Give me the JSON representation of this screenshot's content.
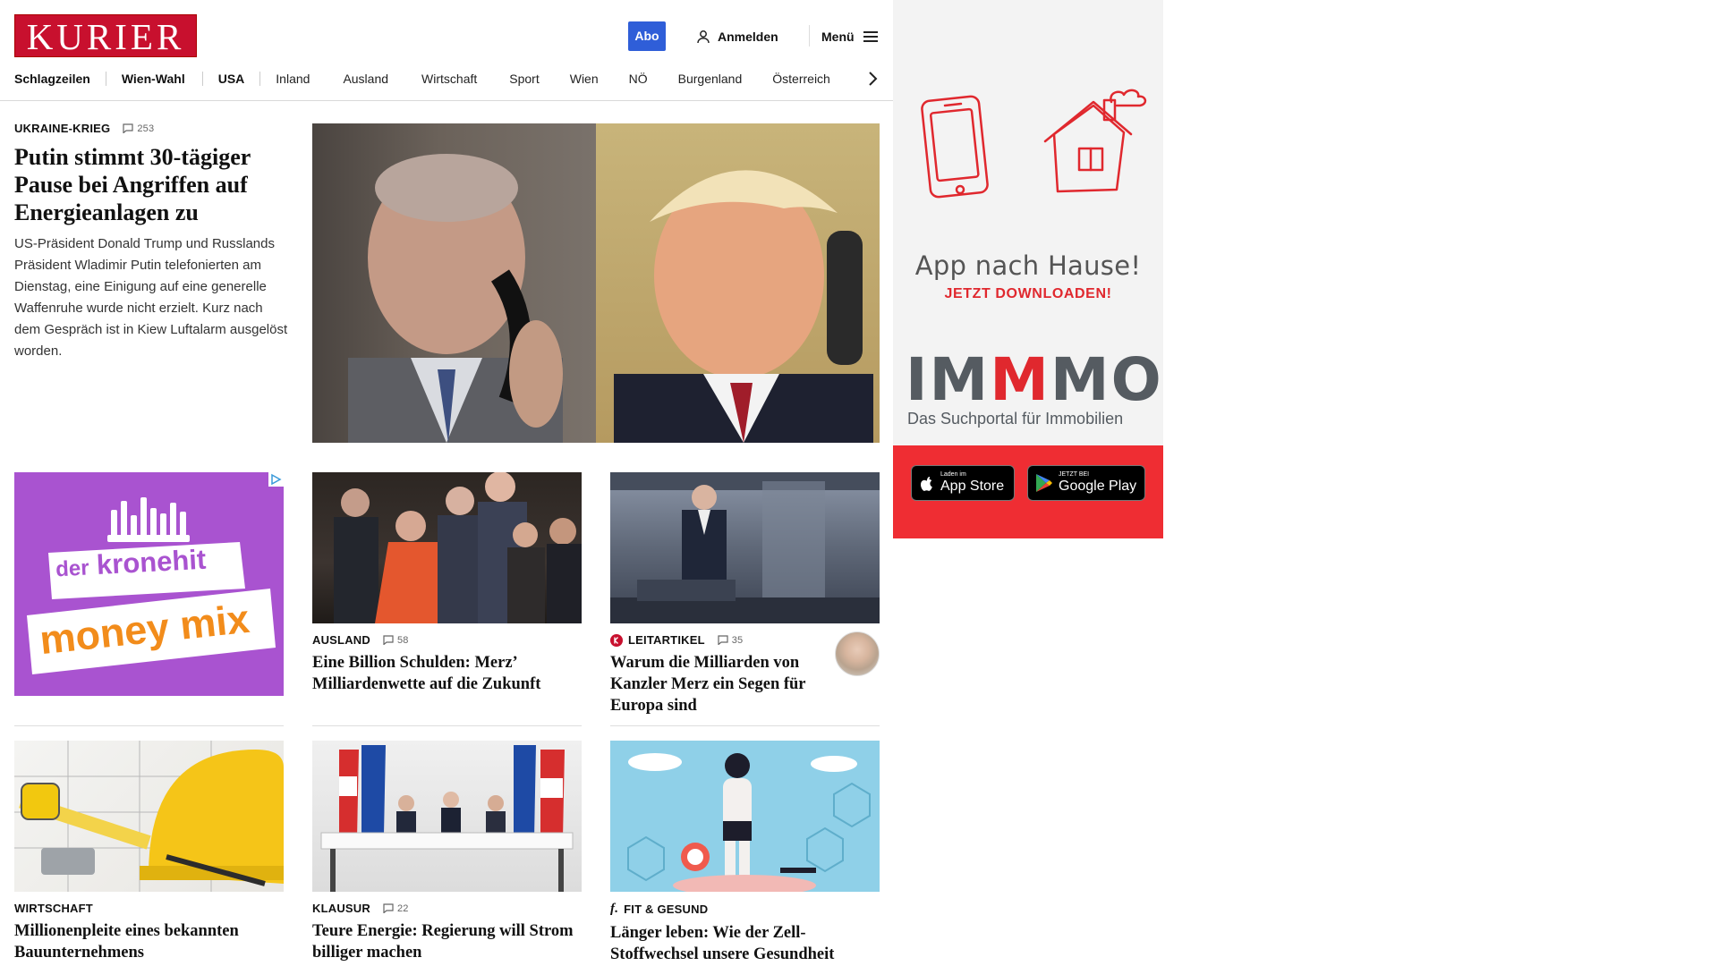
{
  "header": {
    "logo": "KURIER",
    "abo_label": "Abo",
    "login_label": "Anmelden",
    "menu_label": "Menü"
  },
  "nav": {
    "items": [
      {
        "label": "Schlagzeilen",
        "strong": true
      },
      {
        "label": "Wien-Wahl",
        "strong": true
      },
      {
        "label": "USA",
        "strong": true
      },
      {
        "label": "Inland",
        "strong": false
      },
      {
        "label": "Ausland",
        "strong": false
      },
      {
        "label": "Wirtschaft",
        "strong": false
      },
      {
        "label": "Sport",
        "strong": false
      },
      {
        "label": "Wien",
        "strong": false
      },
      {
        "label": "NÖ",
        "strong": false
      },
      {
        "label": "Burgenland",
        "strong": false
      },
      {
        "label": "Österreich",
        "strong": false
      }
    ]
  },
  "lead": {
    "kicker": "UKRAINE-KRIEG",
    "comments": "253",
    "headline": "Putin stimmt 30-tägiger Pause bei Angriffen auf Energieanlagen zu",
    "teaser": "US-Präsident Donald Trump und Russlands Präsident Wladimir Putin telefonierten am Dienstag, eine Einigung auf eine generelle Waffenruhe wurde nicht erzielt. Kurz nach dem Gespräch ist in Kiew Luftalarm ausgelöst worden."
  },
  "ad": {
    "line1": "der",
    "line2": "kronehit",
    "line3": "money mix"
  },
  "cards_row1": [
    {
      "kicker": "AUSLAND",
      "comments": "58",
      "headline": "Eine Billion Schulden: Merz’ Milliardenwette auf die Zukunft"
    },
    {
      "kicker": "LEITARTIKEL",
      "comments": "35",
      "headline": "Warum die Milliarden von Kanzler Merz ein Segen für Europa sind"
    }
  ],
  "cards_row2": [
    {
      "kicker": "WIRTSCHAFT",
      "comments": "",
      "headline": "Millionenpleite eines bekannten Bauunternehmens"
    },
    {
      "kicker": "KLAUSUR",
      "comments": "22",
      "headline": "Teure Energie: Regierung will Strom billiger machen"
    },
    {
      "kicker": "FIT & GESUND",
      "comments": "",
      "headline": "Länger leben: Wie der Zell-Stoffwechsel unsere Gesundheit steuert"
    }
  ],
  "rail": {
    "title": "App nach Hause!",
    "subtitle": "JETZT DOWNLOADEN!",
    "brand_a": "IM",
    "brand_b": "M",
    "brand_c": "MO",
    "brand_sub": "Das Suchportal für Immobilien",
    "appstore_small": "Laden im",
    "appstore_big": "App Store",
    "gplay_small": "JETZT BEI",
    "gplay_big": "Google Play"
  },
  "colors": {
    "brand_red": "#c8102e",
    "abo_blue": "#2f5ed8",
    "ad_purple": "#a953d0",
    "immmo_red": "#e0282e"
  }
}
